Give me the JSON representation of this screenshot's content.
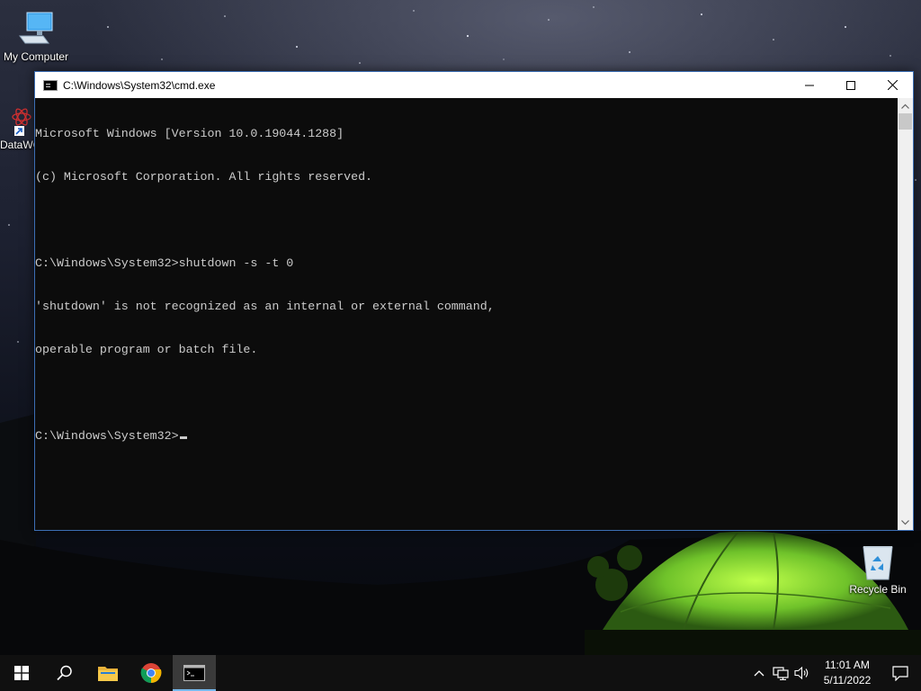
{
  "desktop": {
    "icons": [
      {
        "label": "My Computer",
        "icon": "computer-icon"
      },
      {
        "label": "DataWC",
        "icon": "datawc-app-icon"
      },
      {
        "label": "Recycle Bin",
        "icon": "recycle-bin-icon"
      }
    ]
  },
  "window": {
    "title": "C:\\Windows\\System32\\cmd.exe",
    "controls": {
      "minimize": "minimize",
      "maximize": "maximize",
      "close": "close"
    },
    "console_lines": [
      "Microsoft Windows [Version 10.0.19044.1288]",
      "(c) Microsoft Corporation. All rights reserved.",
      "",
      "C:\\Windows\\System32>shutdown -s -t 0",
      "'shutdown' is not recognized as an internal or external command,",
      "operable program or batch file.",
      "",
      "C:\\Windows\\System32>"
    ],
    "colors": {
      "background": "#0c0c0c",
      "text": "#cccccc"
    }
  },
  "taskbar": {
    "items": [
      {
        "icon": "windows-start-icon"
      },
      {
        "icon": "search-icon"
      },
      {
        "icon": "file-explorer-icon"
      },
      {
        "icon": "chrome-icon"
      },
      {
        "icon": "command-prompt-icon",
        "active": true
      }
    ],
    "tray": {
      "icons": [
        "chevron-up-icon",
        "network-icon",
        "volume-icon"
      ],
      "time": "11:01 AM",
      "date": "5/11/2022"
    },
    "colors": {
      "background": "#101010",
      "active_indicator": "#76b9ed"
    }
  }
}
